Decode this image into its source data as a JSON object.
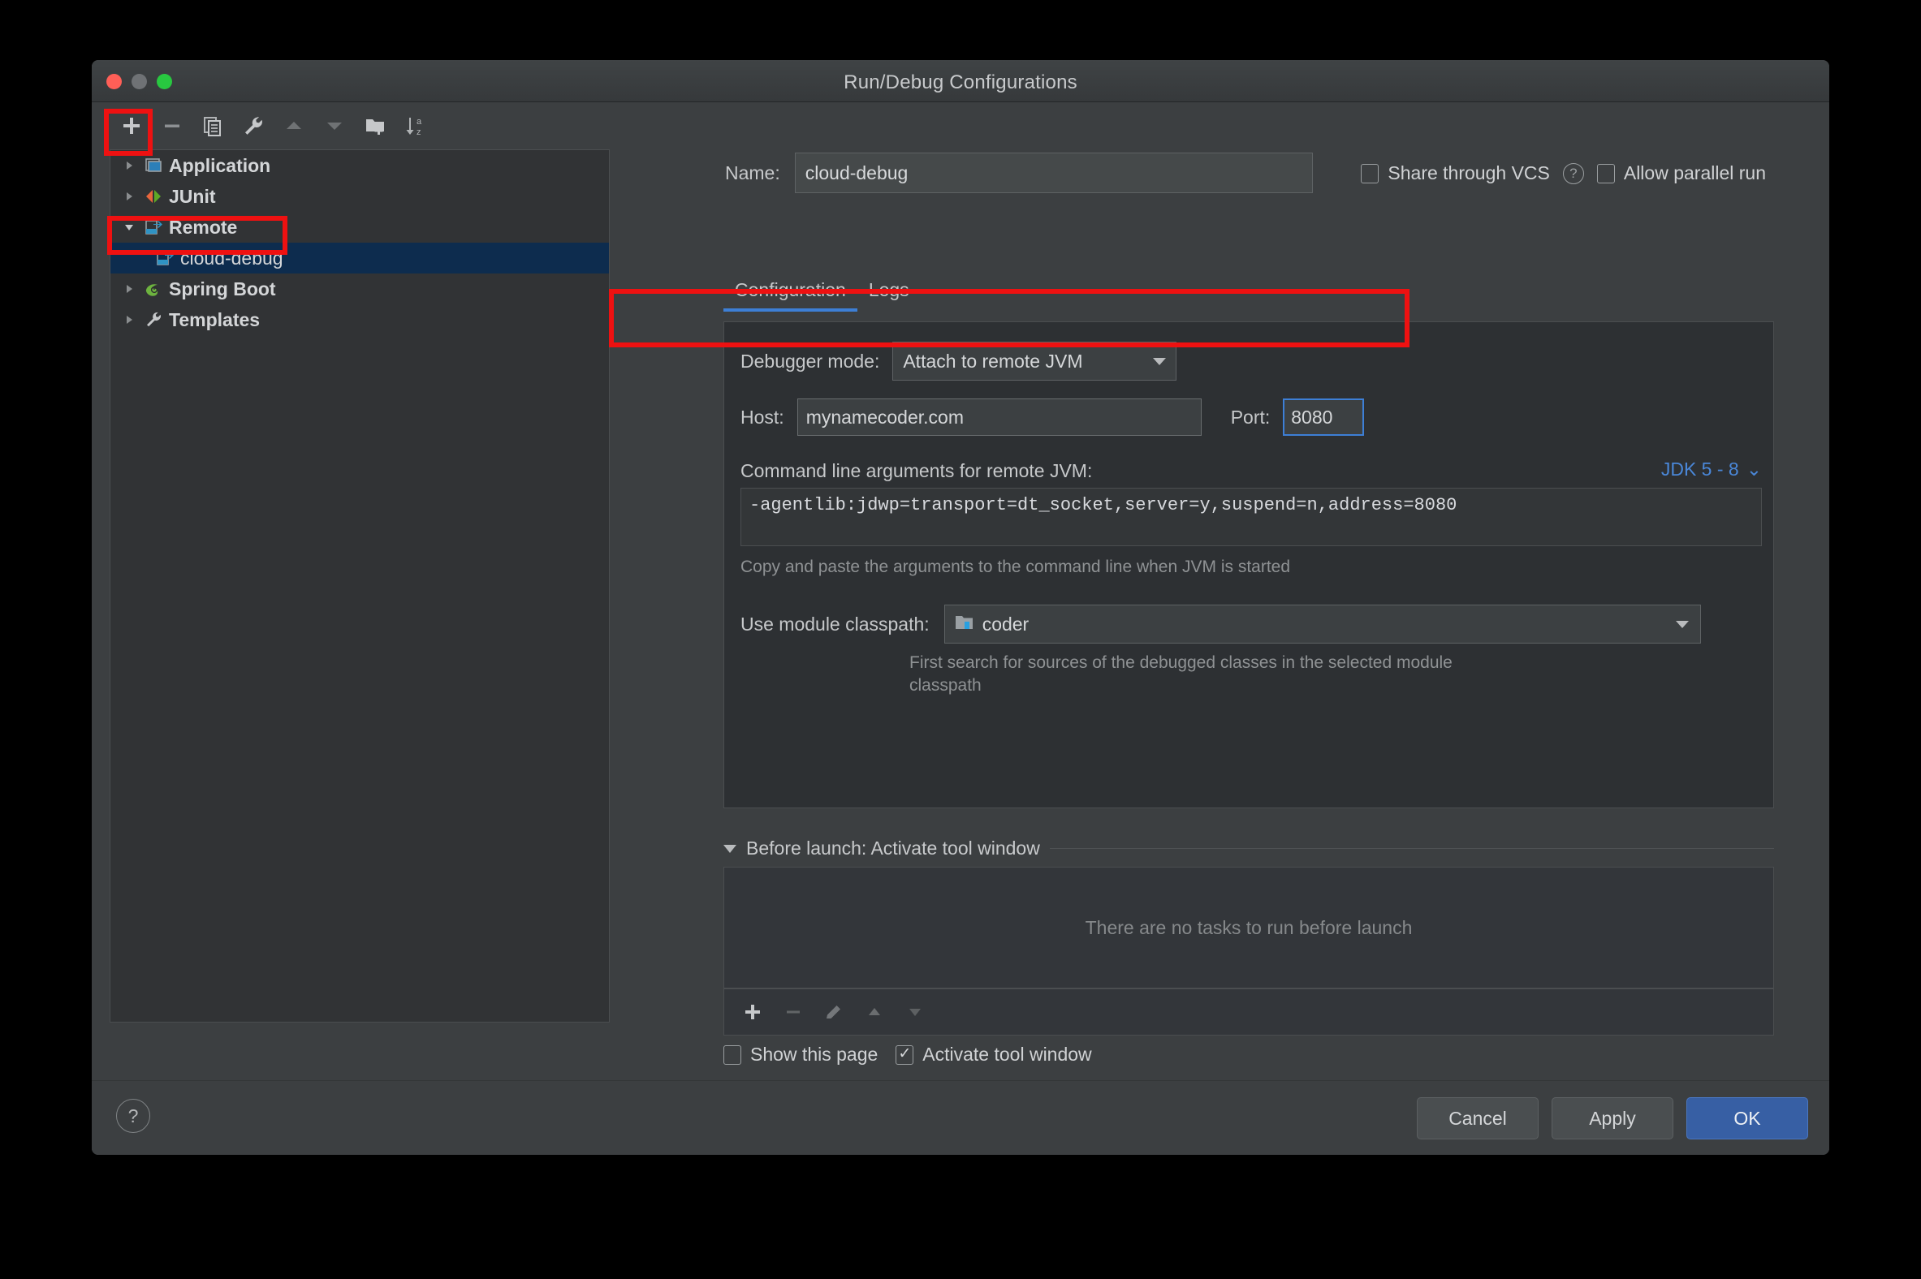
{
  "window": {
    "title": "Run/Debug Configurations",
    "traffic_lights": [
      "close-button",
      "minimize-button",
      "zoom-button"
    ]
  },
  "tree_toolbar": {
    "buttons": [
      {
        "name": "add-configuration-button",
        "icon": "plus-icon"
      },
      {
        "name": "remove-configuration-button",
        "icon": "minus-icon"
      },
      {
        "name": "copy-configuration-button",
        "icon": "copy-icon"
      },
      {
        "name": "edit-templates-button",
        "icon": "wrench-icon"
      },
      {
        "name": "move-up-button",
        "icon": "triangle-up-icon"
      },
      {
        "name": "move-down-button",
        "icon": "triangle-down-icon"
      },
      {
        "name": "move-into-folder-button",
        "icon": "folder-add-icon"
      },
      {
        "name": "sort-configurations-button",
        "icon": "sort-az-icon"
      }
    ]
  },
  "tree": {
    "items": [
      {
        "label": "Application",
        "icon": "application-icon",
        "expandable": true,
        "expanded": false,
        "child": false,
        "selected": false
      },
      {
        "label": "JUnit",
        "icon": "junit-icon",
        "expandable": true,
        "expanded": false,
        "child": false,
        "selected": false
      },
      {
        "label": "Remote",
        "icon": "remote-icon",
        "expandable": true,
        "expanded": true,
        "child": false,
        "selected": false
      },
      {
        "label": "cloud-debug",
        "icon": "remote-icon",
        "expandable": false,
        "expanded": false,
        "child": true,
        "selected": true
      },
      {
        "label": "Spring Boot",
        "icon": "spring-boot-icon",
        "expandable": true,
        "expanded": false,
        "child": false,
        "selected": false
      },
      {
        "label": "Templates",
        "icon": "wrench-icon",
        "expandable": true,
        "expanded": false,
        "child": false,
        "selected": false
      }
    ]
  },
  "header": {
    "name_label": "Name:",
    "name_value": "cloud-debug",
    "share_vcs_label": "Share through VCS",
    "share_vcs_checked": false,
    "vcs_help_glyph": "?",
    "allow_parallel_label": "Allow parallel run",
    "allow_parallel_checked": false
  },
  "tabs": [
    {
      "label": "Configuration",
      "active": true
    },
    {
      "label": "Logs",
      "active": false
    }
  ],
  "configuration": {
    "debugger_mode_label": "Debugger mode:",
    "debugger_mode_value": "Attach to remote JVM",
    "host_label": "Host:",
    "host_value": "mynamecoder.com",
    "port_label": "Port:",
    "port_value": "8080",
    "cmdline_label": "Command line arguments for remote JVM:",
    "jdk_selector": "JDK 5 - 8",
    "cmdline_value": "-agentlib:jdwp=transport=dt_socket,server=y,suspend=n,address=8080",
    "cmdline_hint": "Copy and paste the arguments to the command line when JVM is started",
    "classpath_label": "Use module classpath:",
    "classpath_value": "coder",
    "classpath_hint": "First search for sources of the debugged classes in the selected module classpath"
  },
  "before_launch": {
    "title": "Before launch: Activate tool window",
    "empty_message": "There are no tasks to run before launch",
    "toolbar": [
      {
        "name": "add-task-button",
        "icon": "plus-icon"
      },
      {
        "name": "remove-task-button",
        "icon": "minus-icon"
      },
      {
        "name": "edit-task-button",
        "icon": "pencil-icon"
      },
      {
        "name": "move-task-up-button",
        "icon": "triangle-up-icon"
      },
      {
        "name": "move-task-down-button",
        "icon": "triangle-down-icon"
      }
    ],
    "show_page_label": "Show this page",
    "show_page_checked": false,
    "activate_window_label": "Activate tool window",
    "activate_window_checked": true
  },
  "footer": {
    "help_glyph": "?",
    "cancel_label": "Cancel",
    "apply_label": "Apply",
    "ok_label": "OK"
  },
  "colors": {
    "dialog_bg": "#3c3f41",
    "panel_bg": "#2d3033",
    "tree_bg": "#313335",
    "selection": "#0d2c4e",
    "accent_blue": "#3d7fd6",
    "link_blue": "#4a87d8",
    "annotation_red": "#ee1111",
    "primary_button": "#375fa4"
  },
  "annotations": [
    {
      "name": "annotation-add-button",
      "target": "add-configuration-button"
    },
    {
      "name": "annotation-remote-node",
      "target": "tree-item-remote"
    },
    {
      "name": "annotation-host-port",
      "target": "host-port-row"
    }
  ]
}
